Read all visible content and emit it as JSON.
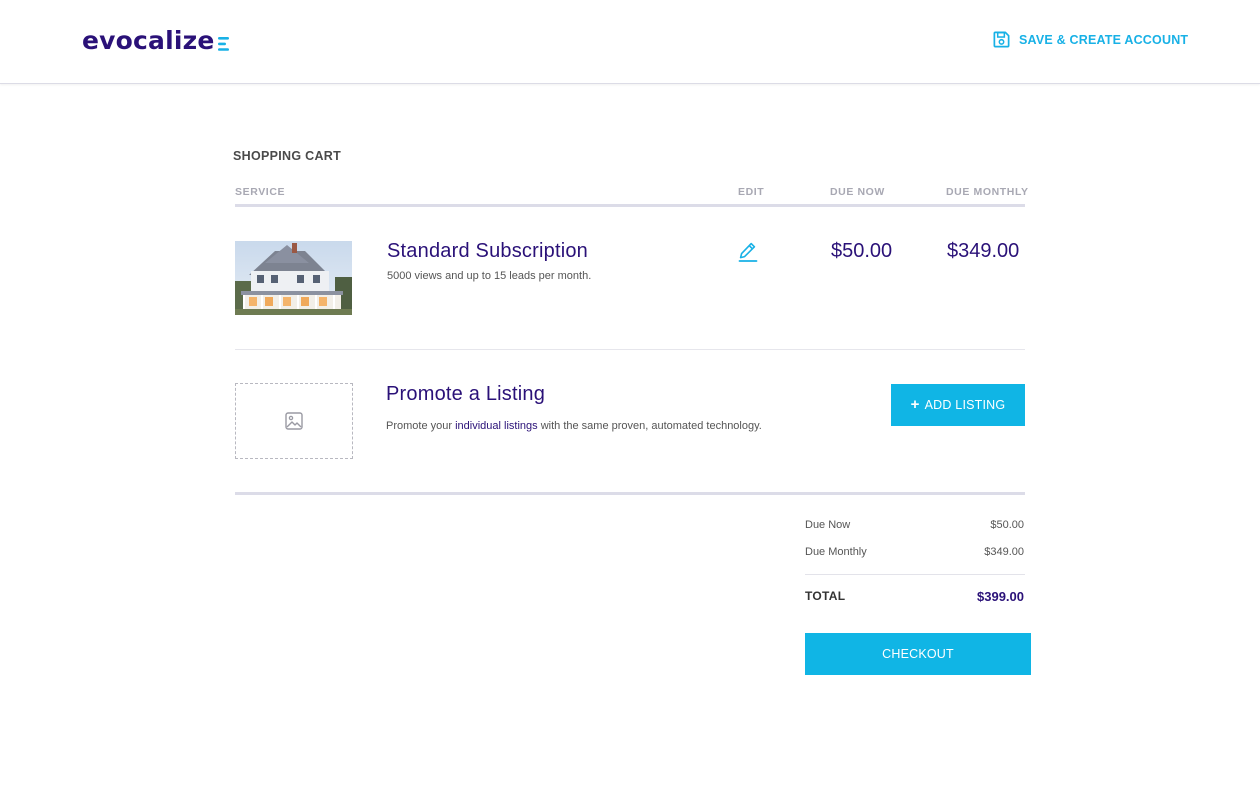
{
  "header": {
    "logo_text": "evocalize",
    "save_label": "SAVE & CREATE ACCOUNT"
  },
  "cart": {
    "title": "SHOPPING CART",
    "columns": {
      "service": "SERVICE",
      "edit": "EDIT",
      "due_now": "DUE NOW",
      "due_monthly": "DUE MONTHLY"
    },
    "subscription": {
      "name": "Standard Subscription",
      "description": "5000 views and up to 15 leads per month.",
      "due_now": "$50.00",
      "due_monthly": "$349.00"
    },
    "promote": {
      "name": "Promote a Listing",
      "description_before": "Promote your ",
      "description_link": "individual listings",
      "description_after": " with the same proven, automated technology.",
      "add_label": "ADD LISTING"
    }
  },
  "summary": {
    "due_now_label": "Due Now",
    "due_now_value": "$50.00",
    "due_monthly_label": "Due Monthly",
    "due_monthly_value": "$349.00",
    "total_label": "TOTAL",
    "total_value": "$399.00",
    "checkout_label": "CHECKOUT"
  },
  "icons": {
    "save": "floppy-disk-icon",
    "edit": "pencil-icon",
    "placeholder": "image-icon",
    "add": "plus-icon"
  },
  "colors": {
    "brand_purple": "#2a1178",
    "accent_cyan": "#10b5e5"
  }
}
